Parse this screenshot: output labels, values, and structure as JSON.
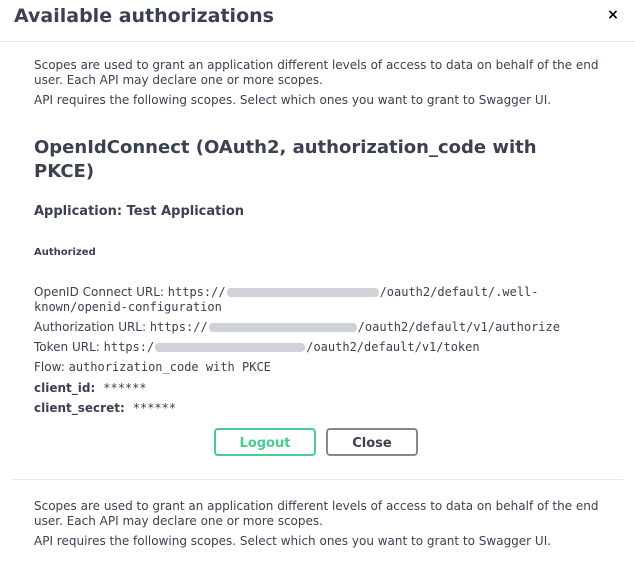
{
  "modal": {
    "title": "Available authorizations",
    "close_glyph": "×"
  },
  "section1": {
    "scopes_line1": "Scopes are used to grant an application different levels of access to data on behalf of the end",
    "scopes_line2": "user. Each API may declare one or more scopes.",
    "requires_text": "API requires the following scopes. Select which ones you want to grant to Swagger UI."
  },
  "scheme": {
    "title": "OpenIdConnect (OAuth2, authorization_code with PKCE)",
    "application": "Application: Test Application",
    "authorized_label": "Authorized",
    "openid_label": "OpenID Connect URL:",
    "openid_prefix": "https://",
    "openid_suffix": "/oauth2/default/.well-",
    "openid_line2": "known/openid-configuration",
    "auth_url_label": "Authorization URL:",
    "auth_url_prefix": "https://",
    "auth_url_suffix": "/oauth2/default/v1/authorize",
    "token_url_label": "Token URL:",
    "token_url_prefix": "https:/",
    "token_url_suffix": "/oauth2/default/v1/token",
    "flow_label": "Flow:",
    "flow_value": "authorization_code with PKCE",
    "client_id_label": "client_id:",
    "client_id_value": "******",
    "client_secret_label": "client_secret:",
    "client_secret_value": "******"
  },
  "buttons": {
    "logout": "Logout",
    "close": "Close"
  },
  "section2": {
    "scopes_line1": "Scopes are used to grant an application different levels of access to data on behalf of the end",
    "scopes_line2": "user. Each API may declare one or more scopes.",
    "requires_text": "API requires the following scopes. Select which ones you want to grant to Swagger UI."
  },
  "colors": {
    "logout_green": "#49cc90",
    "text": "#3b4151",
    "close_border": "#888888"
  }
}
